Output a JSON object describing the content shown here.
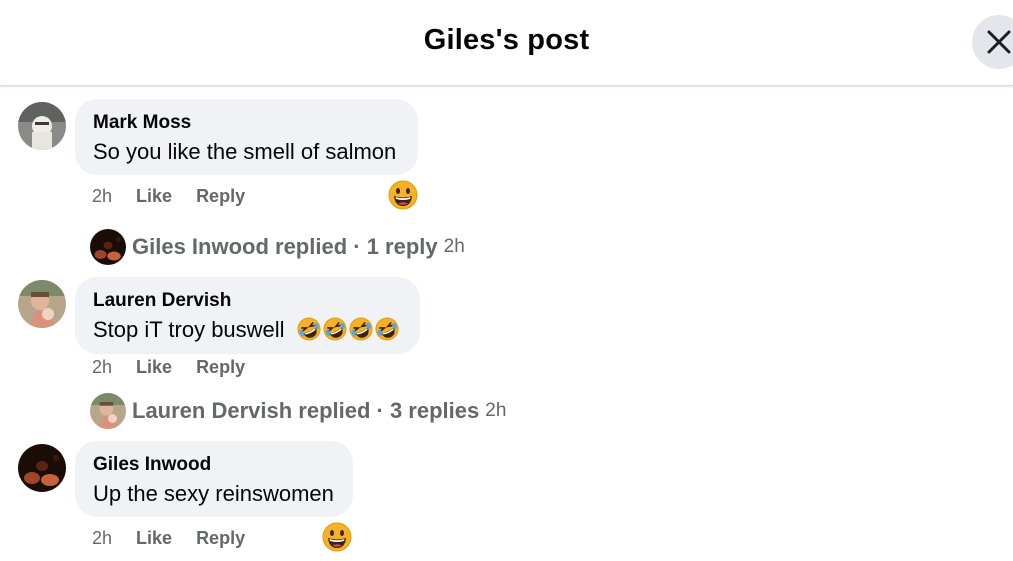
{
  "header": {
    "title": "Giles's post",
    "close_icon": "close-icon"
  },
  "comments": [
    {
      "author": "Mark Moss",
      "text": "So you like the smell of salmon",
      "time": "2h",
      "like_label": "Like",
      "reply_label": "Reply",
      "reaction_icon": "grinning-face-icon",
      "replies": {
        "text": "Giles Inwood replied · 1 reply",
        "time": "2h"
      }
    },
    {
      "author": "Lauren Dervish",
      "text": "Stop iT troy buswell",
      "text_emoji": [
        "rolling-on-floor-laughing-icon",
        "rolling-on-floor-laughing-icon",
        "rolling-on-floor-laughing-icon",
        "rolling-on-floor-laughing-icon"
      ],
      "time": "2h",
      "like_label": "Like",
      "reply_label": "Reply",
      "replies": {
        "text": "Lauren Dervish replied · 3 replies",
        "time": "2h"
      }
    },
    {
      "author": "Giles Inwood",
      "text": "Up the sexy reinswomen",
      "time": "2h",
      "like_label": "Like",
      "reply_label": "Reply",
      "reaction_icon": "grinning-face-icon"
    }
  ],
  "colors": {
    "bubble": "#f0f2f5",
    "secondary_text": "#65676b",
    "primary_text": "#050505",
    "close_bg": "#e4e6eb"
  }
}
